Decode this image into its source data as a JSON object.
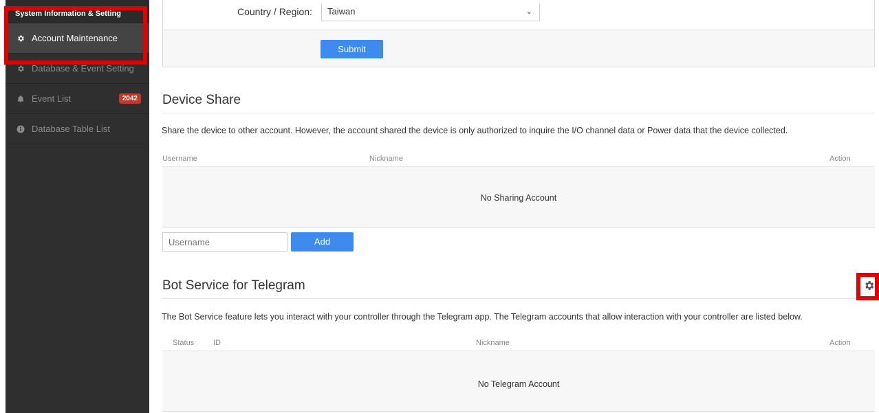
{
  "sidebar": {
    "header": "System Information & Setting",
    "items": [
      {
        "label": "Account Maintenance",
        "icon": "gear-icon"
      },
      {
        "label": "Database & Event Setting",
        "icon": "gear-icon"
      },
      {
        "label": "Event List",
        "icon": "bell-icon",
        "badge": "2042"
      },
      {
        "label": "Database Table List",
        "icon": "info-icon"
      }
    ]
  },
  "country": {
    "label": "Country / Region:",
    "value": "Taiwan",
    "submit_label": "Submit"
  },
  "device_share": {
    "title": "Device Share",
    "description": "Share the device to other account. However, the account shared the device is only authorized to inquire the I/O channel data or Power data that the device collected.",
    "columns": [
      "Username",
      "Nickname",
      "Action"
    ],
    "empty_text": "No Sharing Account",
    "input_placeholder": "Username",
    "add_label": "Add"
  },
  "telegram": {
    "title": "Bot Service for Telegram",
    "description": "The Bot Service feature lets you interact with your controller through the Telegram app. The Telegram accounts that allow interaction with your controller are listed below.",
    "columns": [
      "Status",
      "ID",
      "Nickname",
      "Action"
    ],
    "empty_text": "No Telegram Account"
  },
  "colors": {
    "accent": "#3d8bef",
    "highlight": "#e30000",
    "badge": "#c0392b",
    "sidebar": "#2f2f2f"
  }
}
